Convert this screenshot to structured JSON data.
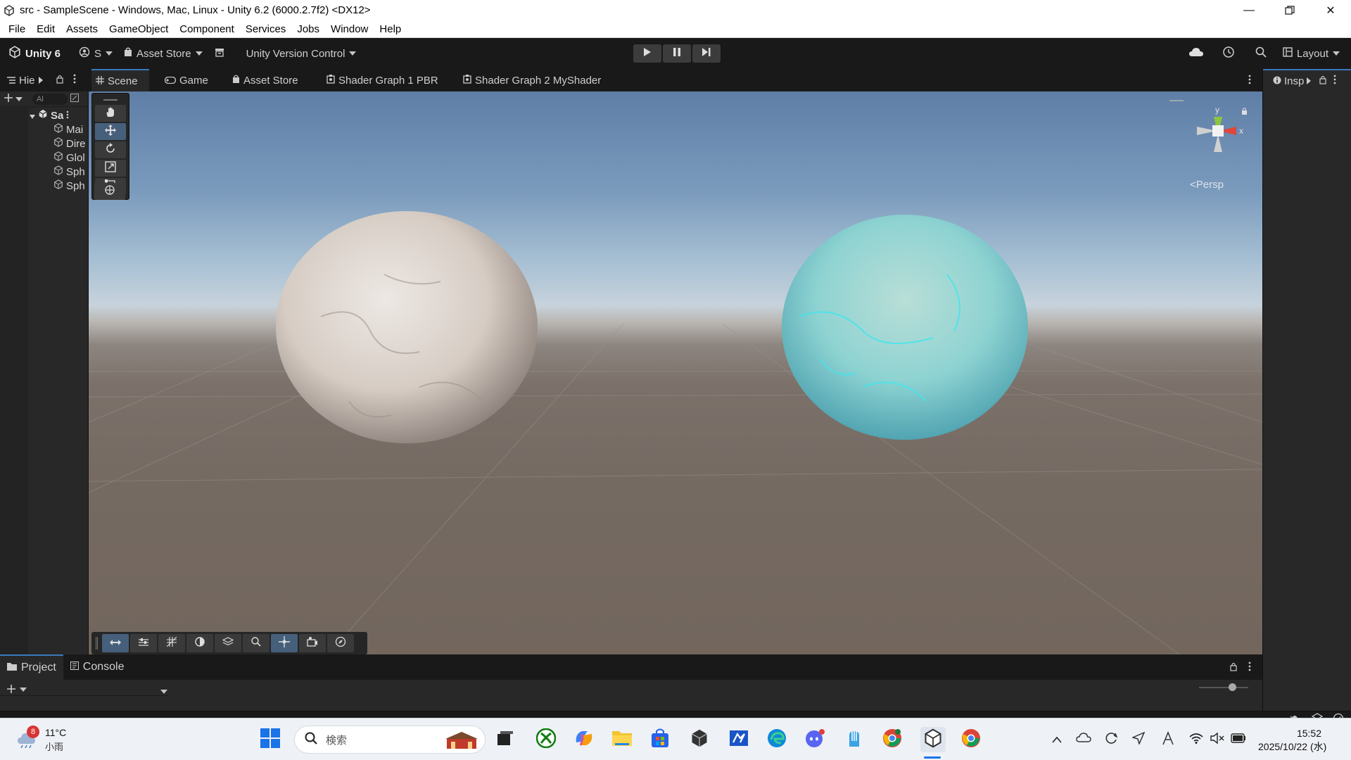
{
  "window": {
    "title": "src - SampleScene - Windows, Mac, Linux - Unity 6.2 (6000.2.7f2) <DX12>",
    "controls": [
      "minimize",
      "restore",
      "close"
    ]
  },
  "menu": [
    "File",
    "Edit",
    "Assets",
    "GameObject",
    "Component",
    "Services",
    "Jobs",
    "Window",
    "Help"
  ],
  "toolbar": {
    "unity_label": "Unity 6",
    "account_label": "S",
    "asset_store_label": "Asset Store",
    "version_control_label": "Unity Version Control",
    "layout_label": "Layout"
  },
  "hierarchy": {
    "tab_label": "Hie",
    "search_placeholder": "Al",
    "scene_name": "Sa",
    "items": [
      "Mai",
      "Dire",
      "Glol",
      "Sph",
      "Sph"
    ]
  },
  "tabs": [
    {
      "label": "Scene",
      "active": true
    },
    {
      "label": "Game",
      "active": false
    },
    {
      "label": "Asset Store",
      "active": false
    },
    {
      "label": "Shader Graph 1 PBR",
      "active": false
    },
    {
      "label": "Shader Graph 2 MyShader",
      "active": false
    }
  ],
  "inspector": {
    "tab_label": "Insp"
  },
  "scene": {
    "projection_label": "Persp",
    "gizmo_axes": [
      "y",
      "x"
    ]
  },
  "bottom_panel": {
    "tabs": [
      "Project",
      "Console"
    ]
  },
  "taskbar": {
    "weather": {
      "badge": "8",
      "temp": "11°C",
      "condition": "小雨"
    },
    "search_placeholder": "検索",
    "clock": {
      "time": "15:52",
      "date": "2025/10/22 (水)"
    }
  },
  "colors": {
    "accent": "#3a79bb",
    "panel": "#282828",
    "toolbar": "#191919",
    "sphere_left": "#d8d0ca",
    "sphere_right": "#8fd8dc"
  }
}
